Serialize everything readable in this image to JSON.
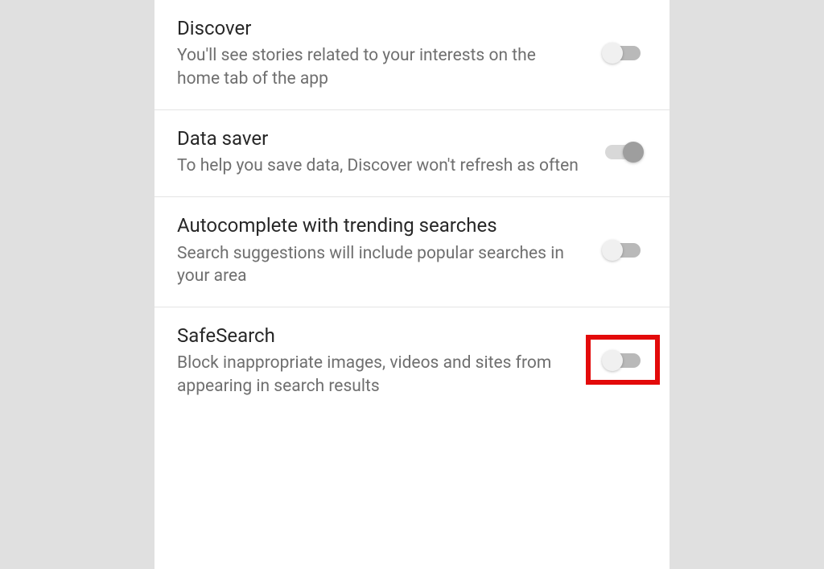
{
  "settings": [
    {
      "title": "Discover",
      "description": "You'll see stories related to your interests on the home tab of the app",
      "state": "off",
      "highlighted": false
    },
    {
      "title": "Data saver",
      "description": "To help you save data, Discover won't refresh as often",
      "state": "on",
      "highlighted": false
    },
    {
      "title": "Autocomplete with trending searches",
      "description": "Search suggestions will include popular searches in your area",
      "state": "off",
      "highlighted": false
    },
    {
      "title": "SafeSearch",
      "description": "Block inappropriate images, videos and sites from appearing in search results",
      "state": "off",
      "highlighted": true
    }
  ]
}
